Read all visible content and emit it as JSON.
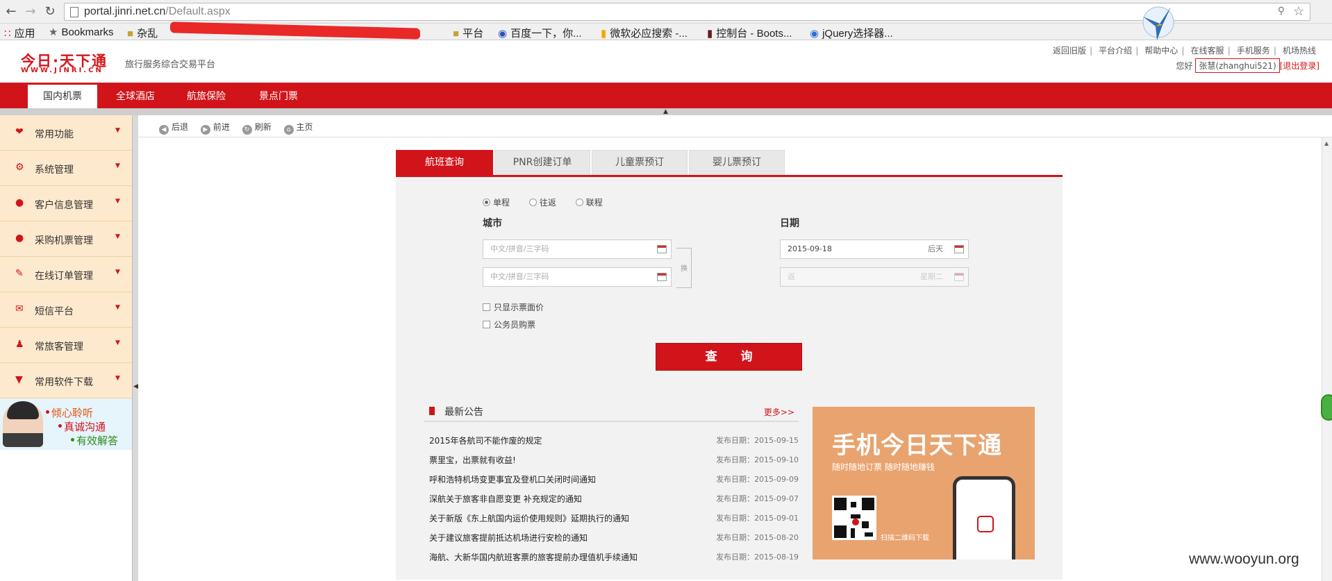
{
  "browser": {
    "url_host": "portal.jinri.net.cn",
    "url_path": "/Default.aspx",
    "bookmarks": [
      {
        "label": "应用",
        "icon": "apps-grid-icon"
      },
      {
        "label": "Bookmarks",
        "icon": "star-icon"
      },
      {
        "label": "杂乱",
        "icon": "folder-icon"
      },
      {
        "label": "平台",
        "icon": "folder-icon"
      },
      {
        "label": "百度一下，你...",
        "icon": "baidu-paw-icon"
      },
      {
        "label": "微软必应搜索 -...",
        "icon": "bing-icon"
      },
      {
        "label": "控制台 - Boots...",
        "icon": "bootstrap-icon"
      },
      {
        "label": "jQuery选择器...",
        "icon": "globe-icon"
      }
    ]
  },
  "site": {
    "logo_text": "今日·天下通",
    "logo_sub": "WWW.JINRI.CN",
    "tagline": "旅行服务综合交易平台",
    "top_links": [
      "返回旧版",
      "平台介绍",
      "帮助中心",
      "在线客服",
      "手机服务",
      "机场热线"
    ],
    "greeting": "您好",
    "username": "张慧(zhanghui521)",
    "logout": "[退出登录]"
  },
  "nav": {
    "tabs": [
      "国内机票",
      "全球酒店",
      "航旅保险",
      "景点门票"
    ],
    "active_index": 0
  },
  "sidebar": {
    "items": [
      {
        "label": "常用功能",
        "icon": "heart-icon"
      },
      {
        "label": "系统管理",
        "icon": "gear-icon"
      },
      {
        "label": "客户信息管理",
        "icon": "user-icon"
      },
      {
        "label": "采购机票管理",
        "icon": "chat-bubble-icon"
      },
      {
        "label": "在线订单管理",
        "icon": "pencil-icon"
      },
      {
        "label": "短信平台",
        "icon": "envelope-icon"
      },
      {
        "label": "常旅客管理",
        "icon": "person-icon"
      },
      {
        "label": "常用软件下载",
        "icon": "download-icon"
      }
    ],
    "banner": [
      "倾心聆听",
      "真诚沟通",
      "有效解答"
    ]
  },
  "toolbar": {
    "back": "后退",
    "forward": "前进",
    "refresh": "刷新",
    "home": "主页"
  },
  "query": {
    "tabs": [
      "航班查询",
      "PNR创建订单",
      "儿童票预订",
      "婴儿票预订"
    ],
    "trip_types": [
      "单程",
      "往返",
      "联程"
    ],
    "selected_trip": "单程",
    "city_label": "城市",
    "date_label": "日期",
    "from_placeholder": "中文/拼音/三字码",
    "to_placeholder": "中文/拼音/三字码",
    "swap_label": "换",
    "depart_date": "2015-09-18",
    "depart_day": "后天",
    "return_date": "返",
    "return_day": "星期二",
    "only_face_price": "只显示票面价",
    "civil_servant": "公务员购票",
    "search_button": "查 询"
  },
  "announcements": {
    "title": "最新公告",
    "more": "更多>>",
    "date_prefix": "发布日期：",
    "items": [
      {
        "title": "2015年各航司不能作废的规定",
        "date": "2015-09-15"
      },
      {
        "title": "票里宝，出票就有收益!",
        "date": "2015-09-10"
      },
      {
        "title": "呼和浩特机场变更事宜及登机口关闭时间通知",
        "date": "2015-09-09"
      },
      {
        "title": "深航关于旅客非自愿变更 补充规定的通知",
        "date": "2015-09-07"
      },
      {
        "title": "关于新版《东上航国内运价使用规则》延期执行的通知",
        "date": "2015-09-01"
      },
      {
        "title": "关于建议旅客提前抵达机场进行安检的通知",
        "date": "2015-08-20"
      },
      {
        "title": "海航、大新华国内航班客票的旅客提前办理值机手续通知",
        "date": "2015-08-19"
      }
    ]
  },
  "promo": {
    "title": "手机今日天下通",
    "subtitle": "随时随地订票  随时随地赚钱",
    "scan": "扫描二维码下载"
  },
  "watermark": "www.wooyun.org",
  "colors": {
    "brand_red": "#d1141a",
    "sidebar_bg": "#fde9cd"
  }
}
